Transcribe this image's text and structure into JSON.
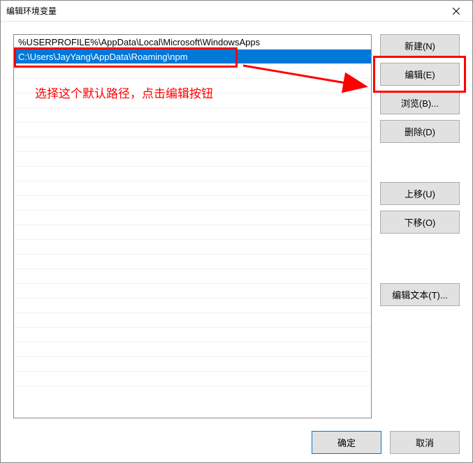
{
  "window": {
    "title": "编辑环境变量"
  },
  "list": {
    "rows": [
      {
        "text": "%USERPROFILE%\\AppData\\Local\\Microsoft\\WindowsApps",
        "selected": false
      },
      {
        "text": "C:\\Users\\JayYang\\AppData\\Roaming\\npm",
        "selected": true
      }
    ]
  },
  "buttons": {
    "new": "新建(N)",
    "edit": "编辑(E)",
    "browse": "浏览(B)...",
    "delete": "删除(D)",
    "move_up": "上移(U)",
    "move_down": "下移(O)",
    "edit_text": "编辑文本(T)..."
  },
  "footer": {
    "ok": "确定",
    "cancel": "取消"
  },
  "annotation": {
    "text": "选择这个默认路径，点击编辑按钮"
  }
}
